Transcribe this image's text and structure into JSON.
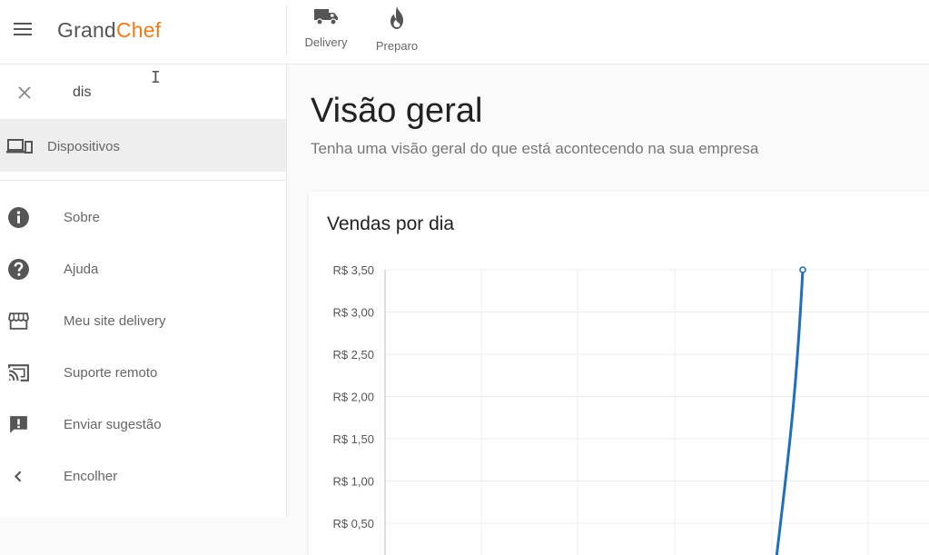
{
  "header": {
    "brand_part1": "Grand",
    "brand_part2": "Chef",
    "brand_color": "#f07a1a",
    "actions": [
      {
        "label": "Delivery",
        "icon": "truck-icon"
      },
      {
        "label": "Preparo",
        "icon": "flame-icon"
      }
    ]
  },
  "sidebar": {
    "search_value": "dis",
    "search_result": {
      "label": "Dispositivos",
      "icon": "devices-icon"
    },
    "items": [
      {
        "label": "Sobre",
        "icon": "info-icon"
      },
      {
        "label": "Ajuda",
        "icon": "help-icon"
      },
      {
        "label": "Meu site delivery",
        "icon": "storefront-icon"
      },
      {
        "label": "Suporte remoto",
        "icon": "cast-icon"
      },
      {
        "label": "Enviar sugestão",
        "icon": "feedback-icon"
      },
      {
        "label": "Encolher",
        "icon": "chevron-left-icon"
      }
    ]
  },
  "main": {
    "title": "Visão geral",
    "subtitle": "Tenha uma visão geral do que está acontecendo na sua empresa"
  },
  "chart_data": {
    "type": "line",
    "title": "Vendas por dia",
    "xlabel": "",
    "ylabel": "",
    "y_ticks": [
      "R$ 3,50",
      "R$ 3,00",
      "R$ 2,50",
      "R$ 2,00",
      "R$ 1,50",
      "R$ 1,00",
      "R$ 0,50"
    ],
    "ylim": [
      0,
      3.5
    ],
    "grid": true,
    "line_color": "#1e6fc0",
    "series": [
      {
        "values": [
          0,
          3.5
        ]
      }
    ]
  }
}
